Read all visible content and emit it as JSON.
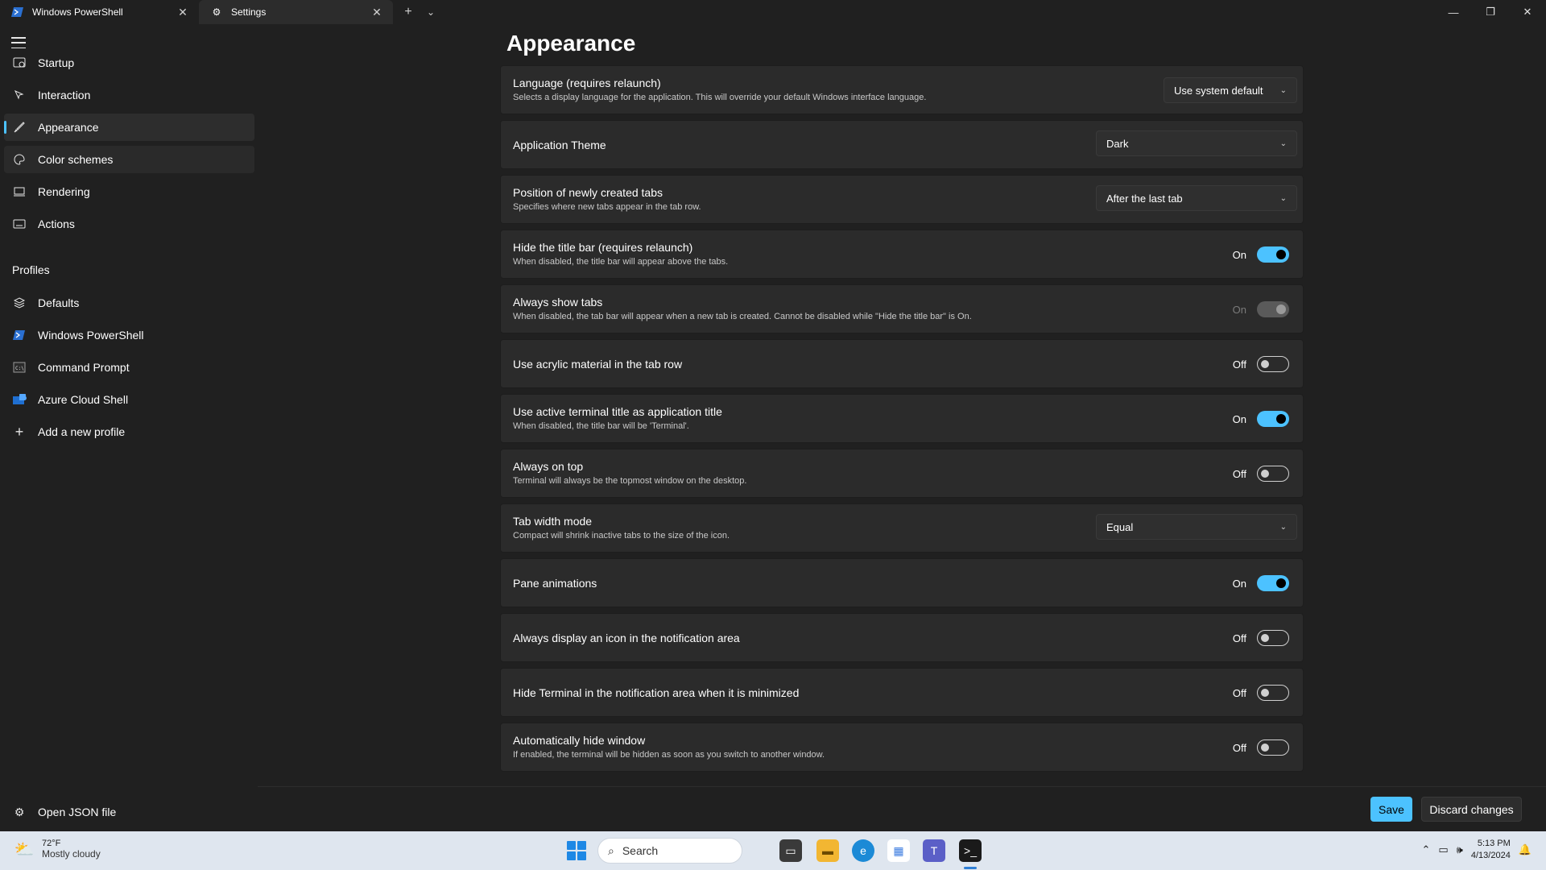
{
  "tabs": [
    {
      "label": "Windows PowerShell",
      "icon": "powershell-icon"
    },
    {
      "label": "Settings",
      "icon": "gear-icon"
    }
  ],
  "sidebar": {
    "items": [
      {
        "label": "Startup",
        "icon": "startup-icon"
      },
      {
        "label": "Interaction",
        "icon": "interaction-icon"
      },
      {
        "label": "Appearance",
        "icon": "brush-icon"
      },
      {
        "label": "Color schemes",
        "icon": "palette-icon"
      },
      {
        "label": "Rendering",
        "icon": "monitor-icon"
      },
      {
        "label": "Actions",
        "icon": "keyboard-icon"
      }
    ],
    "profiles_header": "Profiles",
    "profiles": [
      {
        "label": "Defaults",
        "icon": "layers-icon"
      },
      {
        "label": "Windows PowerShell",
        "icon": "powershell-icon"
      },
      {
        "label": "Command Prompt",
        "icon": "cmd-icon"
      },
      {
        "label": "Azure Cloud Shell",
        "icon": "azure-icon"
      },
      {
        "label": "Add a new profile",
        "icon": "plus-icon"
      }
    ],
    "open_json": "Open JSON file"
  },
  "main": {
    "title": "Appearance",
    "settings": [
      {
        "title": "Language (requires relaunch)",
        "desc": "Selects a display language for the application. This will override your default Windows interface language.",
        "type": "combo",
        "value": "Use system default"
      },
      {
        "title": "Application Theme",
        "desc": "",
        "type": "combo",
        "value": "Dark"
      },
      {
        "title": "Position of newly created tabs",
        "desc": "Specifies where new tabs appear in the tab row.",
        "type": "combo",
        "value": "After the last tab"
      },
      {
        "title": "Hide the title bar (requires relaunch)",
        "desc": "When disabled, the title bar will appear above the tabs.",
        "type": "toggle",
        "value": "On"
      },
      {
        "title": "Always show tabs",
        "desc": "When disabled, the tab bar will appear when a new tab is created. Cannot be disabled while \"Hide the title bar\" is On.",
        "type": "toggle",
        "value": "On",
        "disabled": true
      },
      {
        "title": "Use acrylic material in the tab row",
        "desc": "",
        "type": "toggle",
        "value": "Off"
      },
      {
        "title": "Use active terminal title as application title",
        "desc": "When disabled, the title bar will be 'Terminal'.",
        "type": "toggle",
        "value": "On"
      },
      {
        "title": "Always on top",
        "desc": "Terminal will always be the topmost window on the desktop.",
        "type": "toggle",
        "value": "Off"
      },
      {
        "title": "Tab width mode",
        "desc": "Compact will shrink inactive tabs to the size of the icon.",
        "type": "combo",
        "value": "Equal"
      },
      {
        "title": "Pane animations",
        "desc": "",
        "type": "toggle",
        "value": "On"
      },
      {
        "title": "Always display an icon in the notification area",
        "desc": "",
        "type": "toggle",
        "value": "Off"
      },
      {
        "title": "Hide Terminal in the notification area when it is minimized",
        "desc": "",
        "type": "toggle",
        "value": "Off"
      },
      {
        "title": "Automatically hide window",
        "desc": "If enabled, the terminal will be hidden as soon as you switch to another window.",
        "type": "toggle",
        "value": "Off"
      }
    ]
  },
  "footer": {
    "save": "Save",
    "discard": "Discard changes"
  },
  "taskbar": {
    "weather_temp": "72°F",
    "weather_cond": "Mostly cloudy",
    "search": "Search",
    "time": "5:13 PM",
    "date": "4/13/2024"
  },
  "colors": {
    "accent": "#4cc2ff",
    "background": "#202020",
    "card": "#2b2b2b"
  }
}
